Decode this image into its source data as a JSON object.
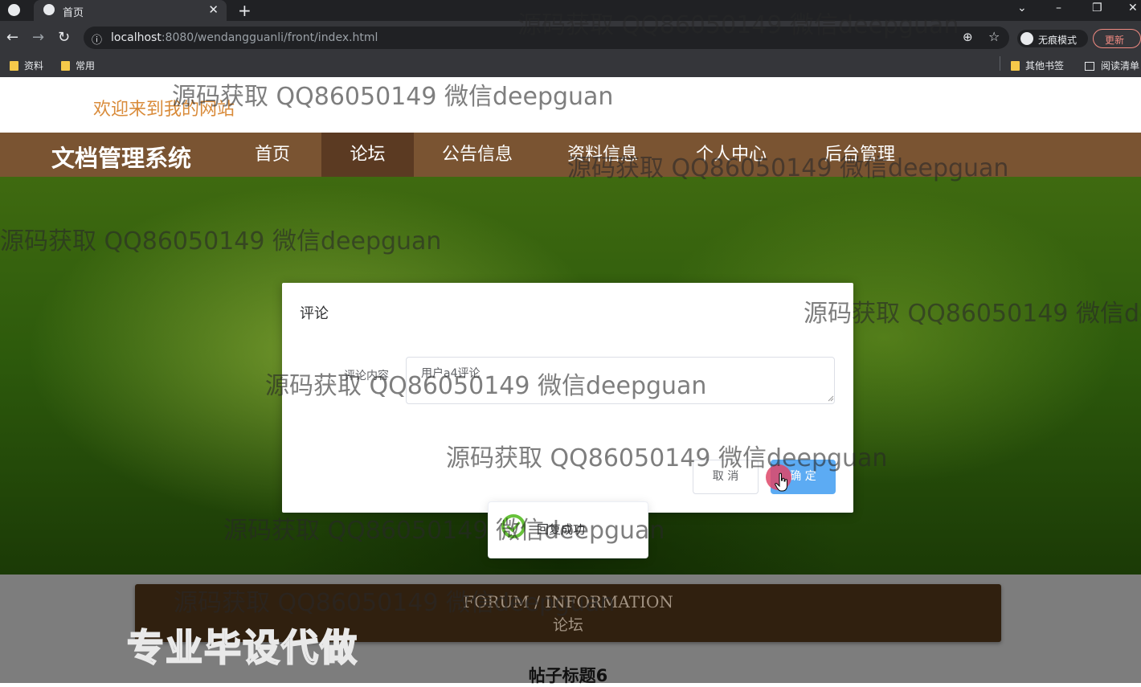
{
  "browser": {
    "tab_title": "首页",
    "tab_close": "✕",
    "new_tab": "+",
    "url_host": "localhost",
    "url_rest": ":8080/wendangguanli/front/index.html",
    "incognito_label": "无痕模式",
    "update_label": "更新",
    "bookmarks": [
      "资料",
      "常用"
    ],
    "other_bookmarks": "其他书签",
    "reading_list": "阅读清单",
    "window_controls": [
      "⌄",
      "–",
      "❐",
      "✕"
    ]
  },
  "site": {
    "welcome": "欢迎来到我的网站",
    "brand": "文档管理系统",
    "nav": [
      "首页",
      "论坛",
      "公告信息",
      "资料信息",
      "个人中心",
      "后台管理"
    ],
    "active_nav": "论坛"
  },
  "dialog": {
    "title": "评论",
    "field_label": "评论内容",
    "field_value": "用户a4评论",
    "cancel_label": "取 消",
    "confirm_label": "确 定"
  },
  "toast": {
    "message": "回复成功"
  },
  "section": {
    "heading_en": "FORUM / INFORMATION",
    "heading_cn": "论坛",
    "post_title": "帖子标题6"
  },
  "overlay": {
    "promo": "专业毕设代做",
    "watermark": "源码获取 QQ86050149 微信deepguan"
  },
  "colors": {
    "nav_bg": "#7a5432",
    "nav_active": "#5b3a22",
    "welcome": "#d98b3a",
    "primary_button": "#5cabf3",
    "success": "#67c23a"
  }
}
